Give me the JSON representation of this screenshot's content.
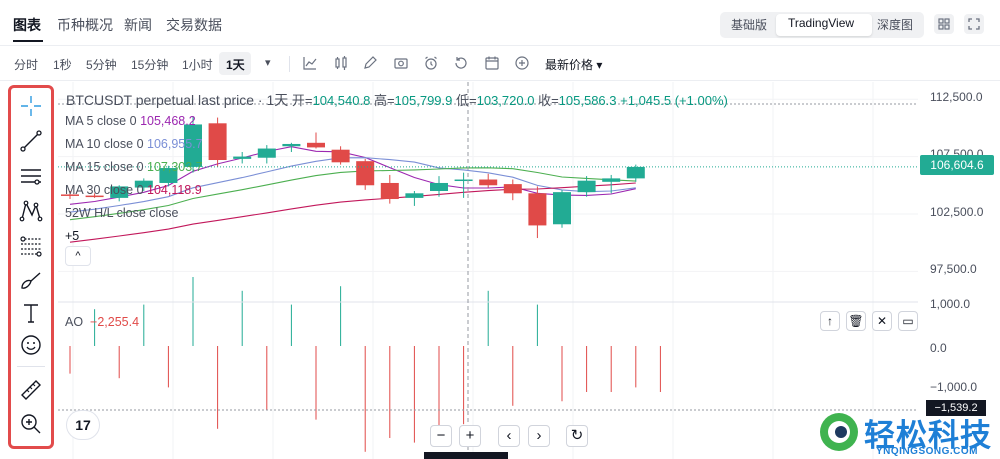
{
  "tabs": [
    {
      "label": "图表",
      "active": true
    },
    {
      "label": "币种概况"
    },
    {
      "label": "新闻"
    },
    {
      "label": "交易数据"
    }
  ],
  "view_switch": [
    "基础版",
    "TradingView",
    "深度图"
  ],
  "timeframes": [
    "分时",
    "1秒",
    "5分钟",
    "15分钟",
    "1小时",
    "1天"
  ],
  "active_timeframe": "1天",
  "timeframe_more": "▾",
  "price_type": "最新价格 ▾",
  "toolbar_icons": [
    "indicators-icon",
    "bar-style-icon",
    "pencil-icon",
    "camera-icon",
    "alarm-icon",
    "replay-icon",
    "calendar-icon",
    "add-icon"
  ],
  "left_tools": [
    "crosshair-icon",
    "trend-line-icon",
    "horizontal-lines-icon",
    "pattern-icon",
    "fib-icon",
    "brush-icon",
    "text-icon",
    "emoji-icon",
    "ruler-icon",
    "zoom-in-icon"
  ],
  "legend": {
    "title": "BTCUSDT perpetual last price · 1天",
    "open_label": "开=",
    "open": "104,540.8",
    "high_label": "高=",
    "high": "105,799.9",
    "low_label": "低=",
    "low": "103,720.0",
    "close_label": "收=",
    "close": "105,586.3",
    "change": "+1,045.5 (+1.00%)"
  },
  "ma": [
    {
      "label": "MA 5 close 0",
      "value": "105,468.2",
      "color": "#9c27b0"
    },
    {
      "label": "MA 10 close 0",
      "value": "106,955.7",
      "color": "#7b8fd6"
    },
    {
      "label": "MA 15 close 0",
      "value": "107,303.7",
      "color": "#4caf50"
    },
    {
      "label": "MA 30 close 0",
      "value": "104,118.9",
      "color": "#c2185b"
    },
    {
      "label": "52W H/L close close",
      "value": "",
      "color": "#4a4f5c"
    }
  ],
  "hidden_count": "+5",
  "collapse_label": "^",
  "ao": {
    "label": "AO",
    "value": "−2,255.4"
  },
  "price_axis": [
    "112,500.0",
    "107,500.0",
    "102,500.0",
    "97,500.0",
    "1,000.0",
    "0.0",
    "−1,000.0"
  ],
  "current_price": "106,604.6",
  "current_ao": "−1,539.2",
  "pane_buttons": [
    "↑",
    "🗑",
    "✕",
    "▭"
  ],
  "nav_buttons": [
    "−",
    "+",
    "‹",
    "›",
    "↻"
  ],
  "logo": "17",
  "watermark": {
    "text": "轻松科技",
    "sub": "YNQINGSONG.COM"
  },
  "colors": {
    "up": "#22ab94",
    "down": "#e04a48",
    "accent": "#2962ff"
  },
  "chart_data": [
    {
      "type": "candlestick",
      "ylim": [
        95000,
        114000
      ],
      "candles": [
        {
          "o": 104200,
          "h": 104500,
          "l": 103800,
          "c": 104100
        },
        {
          "o": 104100,
          "h": 104300,
          "l": 103900,
          "c": 104000
        },
        {
          "o": 103900,
          "h": 105000,
          "l": 103600,
          "c": 104900
        },
        {
          "o": 104800,
          "h": 105600,
          "l": 104500,
          "c": 105400
        },
        {
          "o": 105200,
          "h": 106700,
          "l": 104900,
          "c": 106500
        },
        {
          "o": 106600,
          "h": 111000,
          "l": 106100,
          "c": 110300
        },
        {
          "o": 110400,
          "h": 110900,
          "l": 106600,
          "c": 107200
        },
        {
          "o": 107300,
          "h": 107900,
          "l": 106900,
          "c": 107500
        },
        {
          "o": 107400,
          "h": 108500,
          "l": 106900,
          "c": 108200
        },
        {
          "o": 108400,
          "h": 108700,
          "l": 107900,
          "c": 108600
        },
        {
          "o": 108700,
          "h": 109600,
          "l": 108200,
          "c": 108300
        },
        {
          "o": 108100,
          "h": 108400,
          "l": 106800,
          "c": 107000
        },
        {
          "o": 107100,
          "h": 107300,
          "l": 104600,
          "c": 105000
        },
        {
          "o": 105200,
          "h": 105900,
          "l": 103400,
          "c": 103800
        },
        {
          "o": 103900,
          "h": 104500,
          "l": 103200,
          "c": 104300
        },
        {
          "o": 104500,
          "h": 105800,
          "l": 104000,
          "c": 105200
        },
        {
          "o": 105400,
          "h": 106100,
          "l": 103900,
          "c": 105500
        },
        {
          "o": 105500,
          "h": 106000,
          "l": 104800,
          "c": 105000
        },
        {
          "o": 105100,
          "h": 105500,
          "l": 103700,
          "c": 104300
        },
        {
          "o": 104300,
          "h": 104900,
          "l": 100400,
          "c": 101500
        },
        {
          "o": 101600,
          "h": 104600,
          "l": 101300,
          "c": 104400
        },
        {
          "o": 104400,
          "h": 105800,
          "l": 104000,
          "c": 105400
        },
        {
          "o": 105300,
          "h": 105900,
          "l": 104300,
          "c": 105600
        },
        {
          "o": 105600,
          "h": 106800,
          "l": 105300,
          "c": 106600
        }
      ],
      "ao": [
        -600,
        800,
        -700,
        900,
        -900,
        1500,
        -1800,
        1200,
        -1400,
        900,
        -1600,
        1300,
        -2300,
        -2000,
        -2100,
        -1900,
        -1700,
        1200,
        -1300,
        900,
        -1200,
        -1000,
        -1000,
        -900,
        -1000
      ]
    }
  ]
}
